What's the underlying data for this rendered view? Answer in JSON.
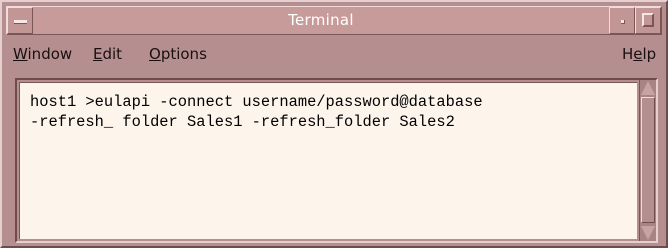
{
  "window": {
    "title": "Terminal",
    "icons": {
      "menu": "window-menu-icon",
      "minimize": "minimize-icon",
      "maximize": "maximize-icon"
    }
  },
  "menubar": {
    "window": {
      "mnemonic": "W",
      "rest": "indow"
    },
    "edit": {
      "mnemonic": "E",
      "rest": "dit"
    },
    "options": {
      "mnemonic": "O",
      "rest": "ptions"
    },
    "help": {
      "lead": "H",
      "mnemonic": "e",
      "rest": "lp"
    }
  },
  "terminal": {
    "lines": [
      "host1 >eulapi -connect username/password@database",
      "-refresh_ folder Sales1 -refresh_folder Sales2"
    ]
  },
  "colors": {
    "window": "#b58f8f",
    "titlebar": "#c89b9b",
    "terminal_bg": "#fdf4ec",
    "text": "#000000"
  }
}
